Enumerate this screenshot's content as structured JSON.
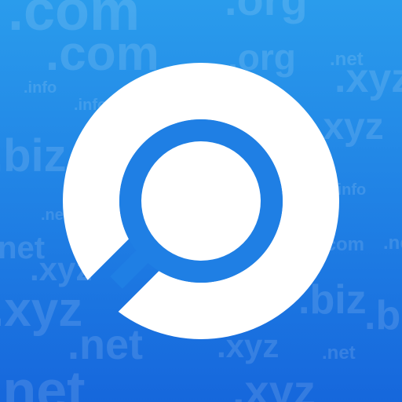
{
  "background_words": [
    ".com",
    ".org",
    ".com",
    ".org",
    ".net",
    ".xyz",
    ".info",
    ".info",
    ".xyz",
    ".biz",
    ".info",
    ".net",
    ".net",
    ".com",
    ".net",
    ".xyz",
    ".biz",
    ".xyz",
    ".biz",
    ".net",
    ".xyz",
    ".net",
    ".net",
    ".xyz"
  ],
  "colors": {
    "gradient_top": "#2a9cec",
    "gradient_bottom": "#1667dc",
    "logo_white": "#ffffff",
    "logo_blue": "#1f7fe4"
  },
  "icons": {
    "logo": "magnifying-glass-in-ring-icon"
  }
}
